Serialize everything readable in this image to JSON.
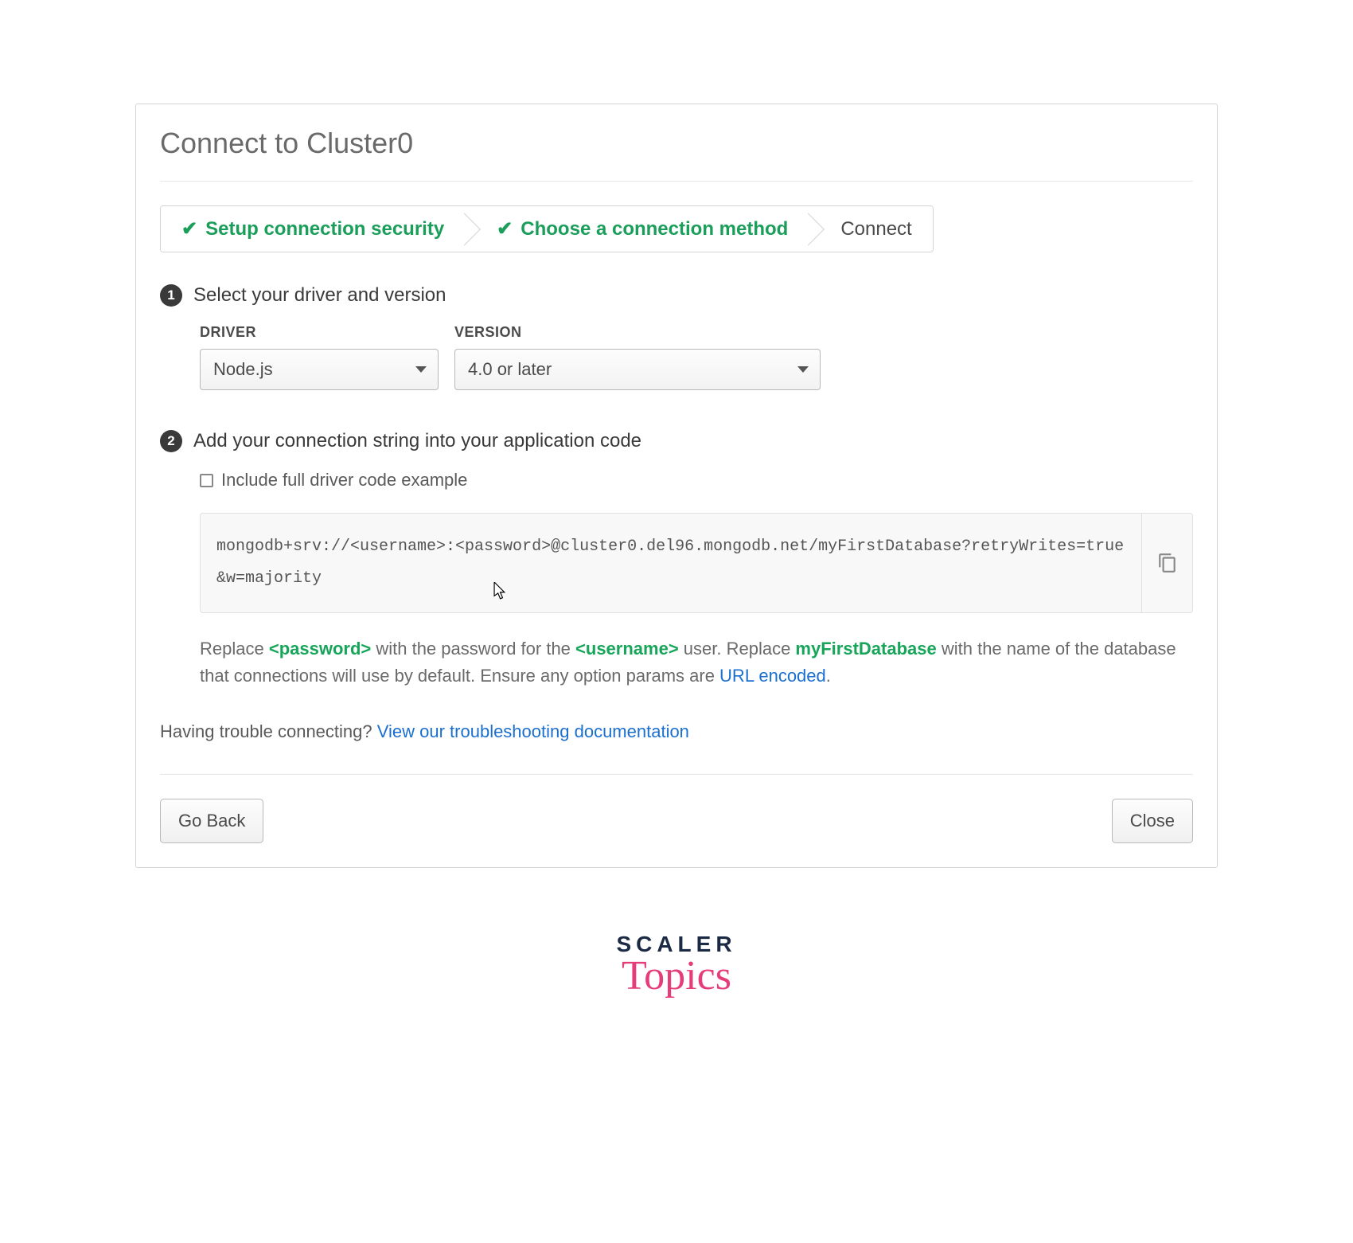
{
  "header": {
    "title": "Connect to Cluster0"
  },
  "stepper": {
    "step1": "Setup connection security",
    "step2": "Choose a connection method",
    "step3": "Connect"
  },
  "section1": {
    "num": "1",
    "label": "Select your driver and version",
    "driverLabel": "DRIVER",
    "driverValue": "Node.js",
    "versionLabel": "VERSION",
    "versionValue": "4.0 or later"
  },
  "section2": {
    "num": "2",
    "label": "Add your connection string into your application code",
    "checkboxLabel": "Include full driver code example",
    "connectionString": "mongodb+srv://<username>:<password>@cluster0.del96.mongodb.net/myFirstDatabase?retryWrites=true&w=majority",
    "help": {
      "t1": "Replace ",
      "password": "<password>",
      "t2": " with the password for the ",
      "username": "<username>",
      "t3": " user. Replace ",
      "db": "myFirstDatabase",
      "t4": " with the name of the database that connections will use by default. Ensure any option params are ",
      "link": "URL encoded",
      "t5": "."
    }
  },
  "trouble": {
    "text": "Having trouble connecting? ",
    "link": "View our troubleshooting documentation"
  },
  "footer": {
    "back": "Go Back",
    "close": "Close"
  },
  "logo": {
    "l1": "SCALER",
    "l2": "Topics"
  }
}
